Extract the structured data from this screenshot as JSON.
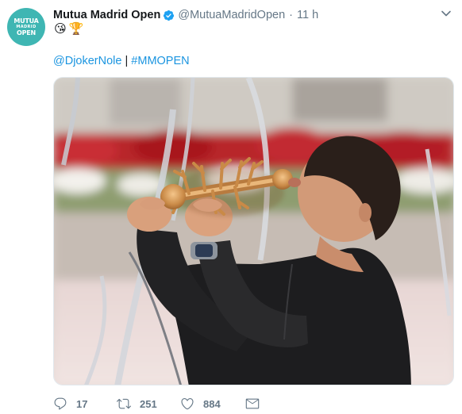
{
  "account": {
    "avatar_text": [
      "MUTUA",
      "MADRID",
      "OPEN"
    ],
    "name": "Mutua Madrid Open",
    "handle": "@MutuaMadridOpen",
    "separator": "·",
    "time": "11 h",
    "verified": true
  },
  "tweet": {
    "emojis": [
      "😘",
      "🏆"
    ],
    "mention": "@DjokerNole",
    "separator": "|",
    "hashtag": "#MMOPEN"
  },
  "actions": {
    "reply_count": "17",
    "retweet_count": "251",
    "like_count": "884"
  },
  "colors": {
    "link": "#1b95e0",
    "muted": "#657786",
    "avatar_bg": "#3fb6b3",
    "verified": "#1da1f2"
  },
  "icons": [
    "verified-badge-icon",
    "chevron-down-icon",
    "reply-icon",
    "retweet-icon",
    "like-icon",
    "message-icon"
  ]
}
